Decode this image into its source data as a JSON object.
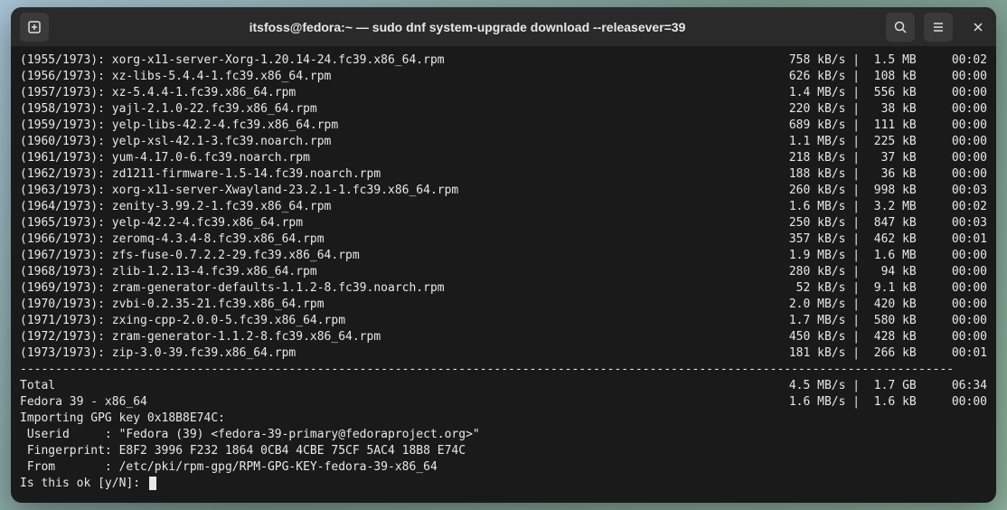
{
  "titlebar": {
    "title": "itsfoss@fedora:~ — sudo dnf system-upgrade download --releasever=39"
  },
  "downloads": [
    {
      "idx": "(1955/1973)",
      "pkg": "xorg-x11-server-Xorg-1.20.14-24.fc39.x86_64.rpm",
      "speed": "758 kB/s",
      "size": "1.5 MB",
      "time": "00:02"
    },
    {
      "idx": "(1956/1973)",
      "pkg": "xz-libs-5.4.4-1.fc39.x86_64.rpm",
      "speed": "626 kB/s",
      "size": "108 kB",
      "time": "00:00"
    },
    {
      "idx": "(1957/1973)",
      "pkg": "xz-5.4.4-1.fc39.x86_64.rpm",
      "speed": "1.4 MB/s",
      "size": "556 kB",
      "time": "00:00"
    },
    {
      "idx": "(1958/1973)",
      "pkg": "yajl-2.1.0-22.fc39.x86_64.rpm",
      "speed": "220 kB/s",
      "size": " 38 kB",
      "time": "00:00"
    },
    {
      "idx": "(1959/1973)",
      "pkg": "yelp-libs-42.2-4.fc39.x86_64.rpm",
      "speed": "689 kB/s",
      "size": "111 kB",
      "time": "00:00"
    },
    {
      "idx": "(1960/1973)",
      "pkg": "yelp-xsl-42.1-3.fc39.noarch.rpm",
      "speed": "1.1 MB/s",
      "size": "225 kB",
      "time": "00:00"
    },
    {
      "idx": "(1961/1973)",
      "pkg": "yum-4.17.0-6.fc39.noarch.rpm",
      "speed": "218 kB/s",
      "size": " 37 kB",
      "time": "00:00"
    },
    {
      "idx": "(1962/1973)",
      "pkg": "zd1211-firmware-1.5-14.fc39.noarch.rpm",
      "speed": "188 kB/s",
      "size": " 36 kB",
      "time": "00:00"
    },
    {
      "idx": "(1963/1973)",
      "pkg": "xorg-x11-server-Xwayland-23.2.1-1.fc39.x86_64.rpm",
      "speed": "260 kB/s",
      "size": "998 kB",
      "time": "00:03"
    },
    {
      "idx": "(1964/1973)",
      "pkg": "zenity-3.99.2-1.fc39.x86_64.rpm",
      "speed": "1.6 MB/s",
      "size": "3.2 MB",
      "time": "00:02"
    },
    {
      "idx": "(1965/1973)",
      "pkg": "yelp-42.2-4.fc39.x86_64.rpm",
      "speed": "250 kB/s",
      "size": "847 kB",
      "time": "00:03"
    },
    {
      "idx": "(1966/1973)",
      "pkg": "zeromq-4.3.4-8.fc39.x86_64.rpm",
      "speed": "357 kB/s",
      "size": "462 kB",
      "time": "00:01"
    },
    {
      "idx": "(1967/1973)",
      "pkg": "zfs-fuse-0.7.2.2-29.fc39.x86_64.rpm",
      "speed": "1.9 MB/s",
      "size": "1.6 MB",
      "time": "00:00"
    },
    {
      "idx": "(1968/1973)",
      "pkg": "zlib-1.2.13-4.fc39.x86_64.rpm",
      "speed": "280 kB/s",
      "size": " 94 kB",
      "time": "00:00"
    },
    {
      "idx": "(1969/1973)",
      "pkg": "zram-generator-defaults-1.1.2-8.fc39.noarch.rpm",
      "speed": " 52 kB/s",
      "size": "9.1 kB",
      "time": "00:00"
    },
    {
      "idx": "(1970/1973)",
      "pkg": "zvbi-0.2.35-21.fc39.x86_64.rpm",
      "speed": "2.0 MB/s",
      "size": "420 kB",
      "time": "00:00"
    },
    {
      "idx": "(1971/1973)",
      "pkg": "zxing-cpp-2.0.0-5.fc39.x86_64.rpm",
      "speed": "1.7 MB/s",
      "size": "580 kB",
      "time": "00:00"
    },
    {
      "idx": "(1972/1973)",
      "pkg": "zram-generator-1.1.2-8.fc39.x86_64.rpm",
      "speed": "450 kB/s",
      "size": "428 kB",
      "time": "00:00"
    },
    {
      "idx": "(1973/1973)",
      "pkg": "zip-3.0-39.fc39.x86_64.rpm",
      "speed": "181 kB/s",
      "size": "266 kB",
      "time": "00:01"
    }
  ],
  "summary": [
    {
      "label": "Total",
      "speed": "4.5 MB/s",
      "size": "1.7 GB",
      "time": "06:34"
    },
    {
      "label": "Fedora 39 - x86_64",
      "speed": "1.6 MB/s",
      "size": "1.6 kB",
      "time": "00:00"
    }
  ],
  "gpg": {
    "importing": "Importing GPG key 0x18B8E74C:",
    "userid_label": " Userid     : ",
    "userid_value": "\"Fedora (39) <fedora-39-primary@fedoraproject.org>\"",
    "fingerprint_label": " Fingerprint: ",
    "fingerprint_value": "E8F2 3996 F232 1864 0CB4 4CBE 75CF 5AC4 18B8 E74C",
    "from_label": " From       : ",
    "from_value": "/etc/pki/rpm-gpg/RPM-GPG-KEY-fedora-39-x86_64"
  },
  "prompt": "Is this ok [y/N]: "
}
